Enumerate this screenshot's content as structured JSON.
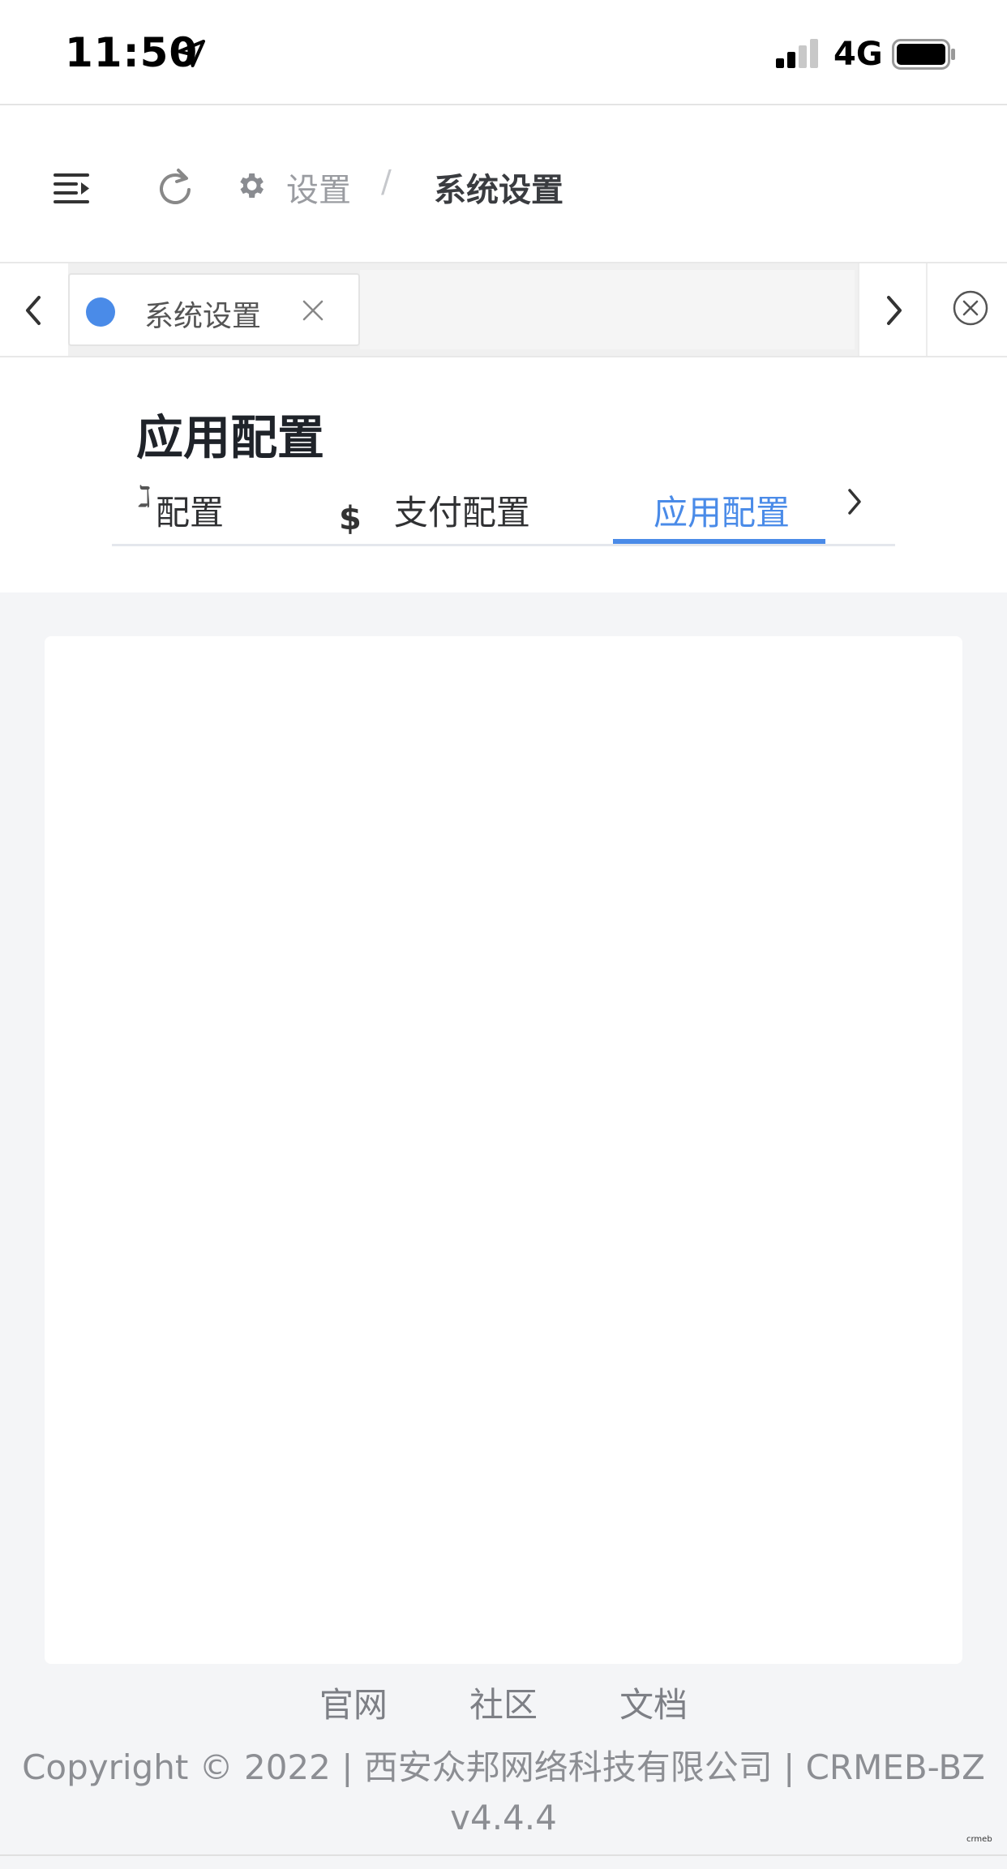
{
  "status_bar": {
    "time": "11:50",
    "network": "4G",
    "icons": [
      "location-arrow-icon",
      "signal-icon",
      "battery-icon"
    ]
  },
  "header": {
    "icons": [
      "hamburger-icon",
      "refresh-icon",
      "gear-icon"
    ],
    "breadcrumb": {
      "parent": "设置",
      "separator": "/",
      "current": "系统设置"
    }
  },
  "tabs_bar": {
    "tabs": [
      {
        "label": "系统设置",
        "active": true
      }
    ],
    "icons": [
      "chevron-left-icon",
      "close-icon",
      "chevron-right-icon",
      "close-all-icon"
    ]
  },
  "page": {
    "title": "应用配置",
    "sub_tabs": [
      {
        "label": "配置",
        "icon": "truncated-icon"
      },
      {
        "label": "支付配置",
        "icon": "dollar-icon",
        "icon_glyph": "$"
      },
      {
        "label": "应用配置",
        "active": true
      }
    ]
  },
  "footer": {
    "links": [
      "官网",
      "社区",
      "文档"
    ],
    "copyright": "Copyright © 2022 | 西安众邦网络科技有限公司 | CRMEB-BZ",
    "version": "v4.4.4",
    "watermark": "crmeb"
  },
  "colors": {
    "accent": "#4a8be8",
    "page_bg": "#f4f5f7",
    "text_muted": "#8c8e93"
  }
}
